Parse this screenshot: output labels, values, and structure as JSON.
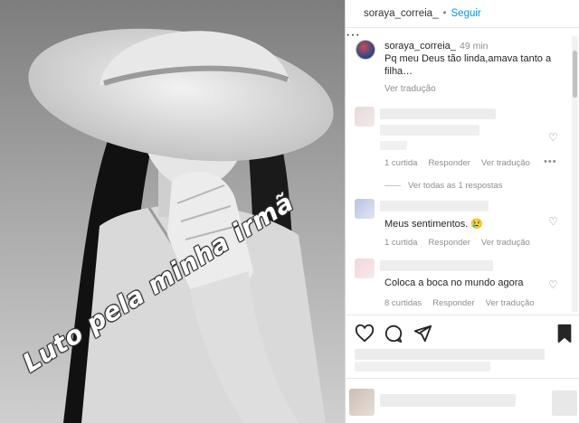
{
  "post": {
    "username": "soraya_correia_",
    "separator": "•",
    "follow_label": "Seguir",
    "more_label": "···",
    "overlay_text": "Luto pela minha irmã"
  },
  "caption": {
    "username": "soraya_correia_",
    "time": "49 min",
    "text": "Pq meu Deus tão linda,amava tanto a filha…",
    "translate_label": "Ver tradução"
  },
  "comments": [
    {
      "text": "",
      "likes_label": "1 curtida",
      "reply_label": "Responder",
      "translate_label": "Ver tradução",
      "more_label": "•••"
    },
    {
      "text": "Meus sentimentos. 😢",
      "likes_label": "1 curtida",
      "reply_label": "Responder",
      "translate_label": "Ver tradução"
    },
    {
      "text": "Coloca a boca no mundo agora",
      "likes_label": "8 curtidas",
      "reply_label": "Responder",
      "translate_label": "Ver tradução"
    }
  ],
  "view_replies_label": "Ver todas as 1 respostas",
  "icons": {
    "heart": "heart-icon",
    "comment": "comment-icon",
    "share": "send-icon",
    "save": "bookmark-icon"
  }
}
